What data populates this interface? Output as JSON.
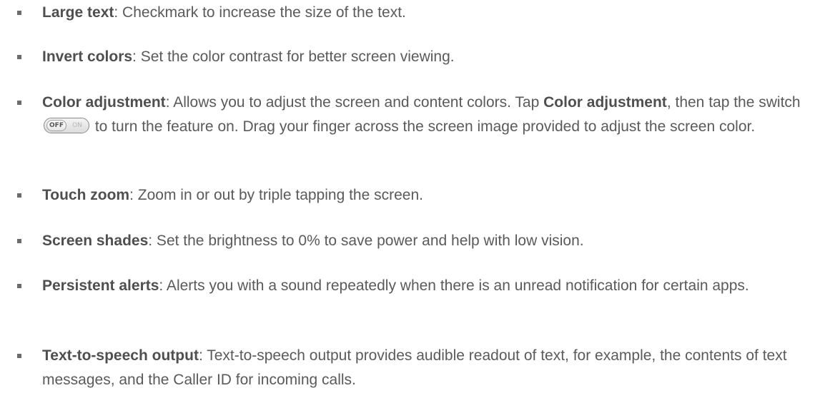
{
  "items": [
    {
      "term": "Large text",
      "desc": ": Checkmark to increase the size of the text."
    },
    {
      "term": "Invert colors",
      "desc": ": Set the color contrast for better screen viewing."
    },
    {
      "term": "Color adjustment",
      "desc_a": ": Allows you to adjust the screen and content colors. Tap ",
      "term2": "Color adjustment",
      "desc_b": ", then tap the switch ",
      "switch": {
        "off": "OFF",
        "on": "ON"
      },
      "desc_c": " to turn the feature on. Drag your finger across the screen image provided to adjust the screen color."
    },
    {
      "term": "Touch zoom",
      "desc": ": Zoom in or out by triple tapping the screen."
    },
    {
      "term": "Screen shades",
      "desc": ": Set the brightness to 0% to save power and help with low vision."
    },
    {
      "term": "Persistent alerts",
      "desc": ": Alerts you with a sound repeatedly when there is an unread notification for certain apps."
    },
    {
      "term": "Text-to-speech output",
      "desc": ": Text-to-speech output provides audible readout of text, for example, the contents of text messages, and the Caller ID for incoming calls."
    }
  ]
}
